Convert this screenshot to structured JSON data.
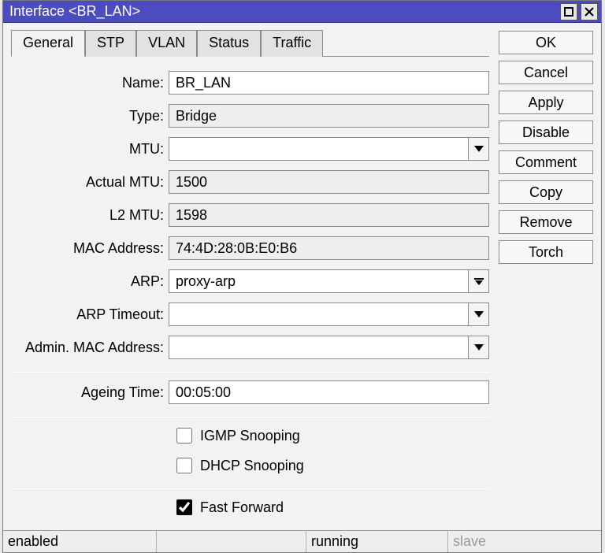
{
  "window": {
    "title": "Interface <BR_LAN>"
  },
  "tabs": [
    "General",
    "STP",
    "VLAN",
    "Status",
    "Traffic"
  ],
  "activeTab": 0,
  "fields": {
    "name": {
      "label": "Name:",
      "value": "BR_LAN"
    },
    "type": {
      "label": "Type:",
      "value": "Bridge"
    },
    "mtu": {
      "label": "MTU:",
      "value": ""
    },
    "actual_mtu": {
      "label": "Actual MTU:",
      "value": "1500"
    },
    "l2_mtu": {
      "label": "L2 MTU:",
      "value": "1598"
    },
    "mac": {
      "label": "MAC Address:",
      "value": "74:4D:28:0B:E0:B6"
    },
    "arp": {
      "label": "ARP:",
      "value": "proxy-arp"
    },
    "arp_timeout": {
      "label": "ARP Timeout:",
      "value": ""
    },
    "admin_mac": {
      "label": "Admin. MAC Address:",
      "value": ""
    },
    "ageing": {
      "label": "Ageing Time:",
      "value": "00:05:00"
    }
  },
  "checkboxes": {
    "igmp": {
      "label": "IGMP Snooping",
      "checked": false
    },
    "dhcp": {
      "label": "DHCP Snooping",
      "checked": false
    },
    "fastfwd": {
      "label": "Fast Forward",
      "checked": true
    }
  },
  "buttons": {
    "ok": "OK",
    "cancel": "Cancel",
    "apply": "Apply",
    "disable": "Disable",
    "comment": "Comment",
    "copy": "Copy",
    "remove": "Remove",
    "torch": "Torch"
  },
  "status": {
    "enabled": "enabled",
    "running": "running",
    "slave": "slave"
  }
}
